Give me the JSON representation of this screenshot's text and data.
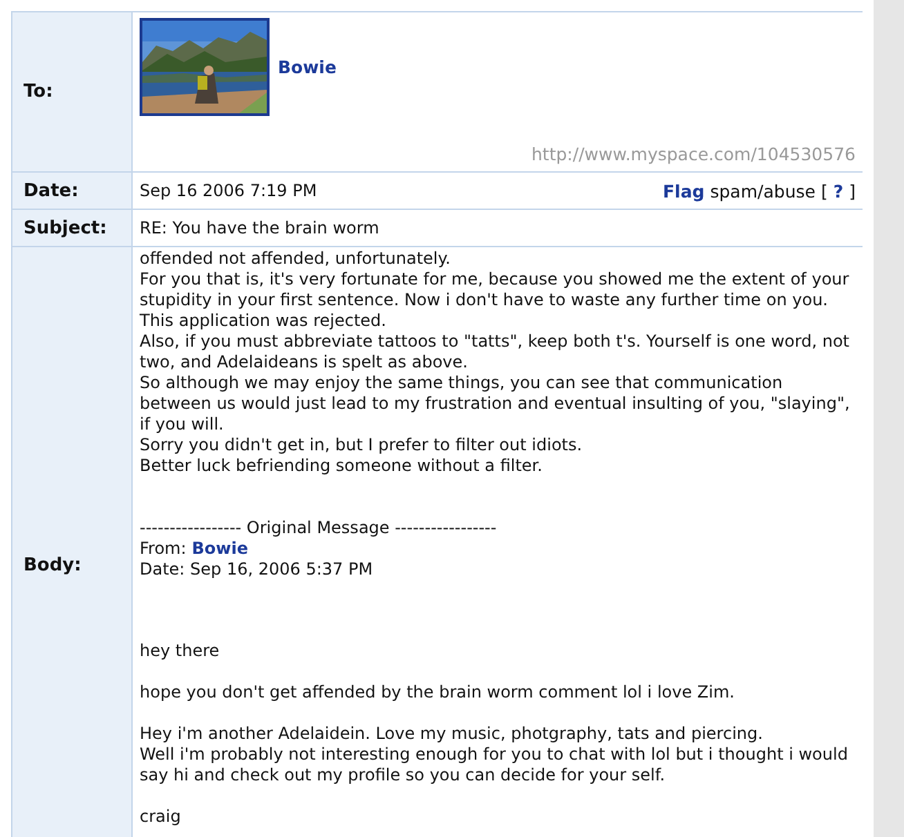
{
  "rows": [
    {
      "kind": "to",
      "label": "To:",
      "name": "Bowie",
      "url": "http://www.myspace.com/104530576"
    },
    {
      "kind": "date",
      "label": "Date:",
      "value": "Sep 16 2006 7:19 PM",
      "flag": "Flag",
      "flag_text": "spam/abuse",
      "help_open": "[",
      "help": "?",
      "help_close": "]"
    },
    {
      "kind": "subject",
      "label": "Subject:",
      "value": "RE: You have the brain worm"
    },
    {
      "kind": "body",
      "label": "Body:",
      "reply": [
        "offended not affended, unfortunately.",
        "For you that is, it's very fortunate for me, because you showed me the extent of your",
        "stupidity in your first sentence. Now i don't have to waste any further time on you.",
        "This application was rejected.",
        "Also, if you must abbreviate tattoos to \"tatts\", keep both t's. Yourself is one word, not",
        "two, and Adelaideans is spelt as above.",
        "So although we may enjoy the same things, you can see that communication",
        "between us would just lead to my frustration and eventual insulting of you, \"slaying\",",
        "if you will.",
        "Sorry you didn't get in, but I prefer to filter out idiots.",
        "Better luck befriending someone without a filter."
      ],
      "original": {
        "divider": "----------------- Original Message -----------------",
        "from_label": "From:",
        "from_name": "Bowie",
        "date": "Date: Sep 16, 2006 5:37 PM"
      },
      "message": [
        [
          "hey there"
        ],
        [
          "hope you don't get affended by the brain worm comment lol i love Zim."
        ],
        [
          "Hey i'm another Adelaidein. Love my music, photgraphy, tats and piercing.",
          "Well i'm probably not interesting enough for you to chat with lol but i thought i would",
          "say hi and check out my profile so you can decide for your self."
        ],
        [
          "craig"
        ]
      ]
    }
  ]
}
